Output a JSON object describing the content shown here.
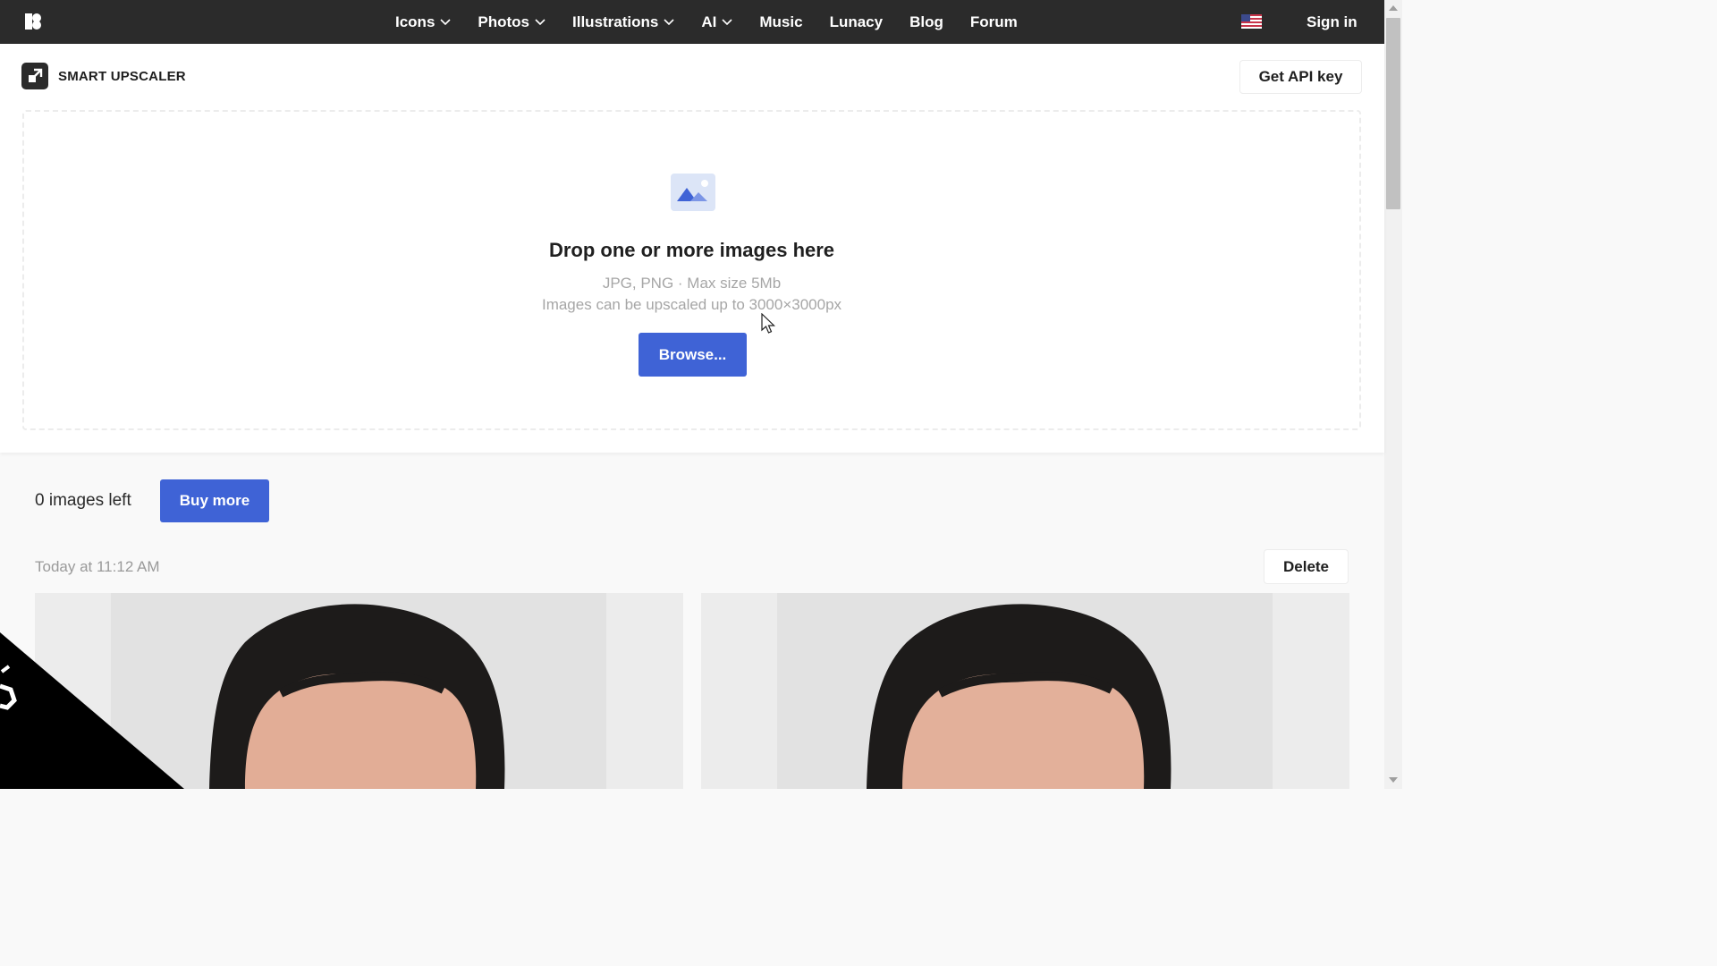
{
  "nav": {
    "items": [
      {
        "label": "Icons",
        "has_dropdown": true
      },
      {
        "label": "Photos",
        "has_dropdown": true
      },
      {
        "label": "Illustrations",
        "has_dropdown": true
      },
      {
        "label": "AI",
        "has_dropdown": true
      },
      {
        "label": "Music",
        "has_dropdown": false
      },
      {
        "label": "Lunacy",
        "has_dropdown": false
      },
      {
        "label": "Blog",
        "has_dropdown": false
      },
      {
        "label": "Forum",
        "has_dropdown": false
      }
    ],
    "signin_label": "Sign in",
    "flag_icon": "us-flag-icon"
  },
  "tool": {
    "title": "SMART UPSCALER",
    "api_button": "Get API key"
  },
  "dropzone": {
    "title": "Drop one or more images here",
    "formats": "JPG, PNG · Max size 5Mb",
    "limit": "Images can be upscaled up to 3000×3000px",
    "browse_label": "Browse..."
  },
  "history": {
    "images_left": "0 images left",
    "buy_label": "Buy more",
    "timestamp": "Today at 11:12 AM",
    "delete_label": "Delete"
  },
  "colors": {
    "nav_bg": "#2b2b2b",
    "accent": "#3f63d6",
    "page_bg": "#f9f9f9"
  }
}
